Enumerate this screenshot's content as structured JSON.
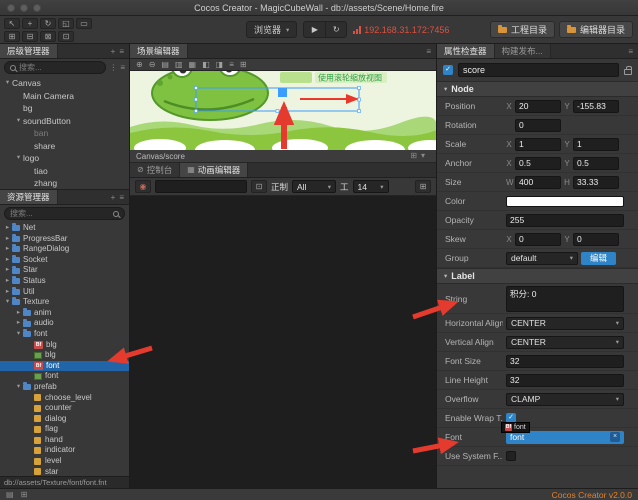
{
  "window": {
    "title": "Cocos Creator - MagicCubeWall - db://assets/Scene/Home.fire"
  },
  "toolbar": {
    "preview_target": "浏览器",
    "ip": "192.168.31.172:7456",
    "project_dir_label": "工程目录",
    "editor_dir_label": "编辑器目录"
  },
  "hierarchy": {
    "tab": "层级管理器",
    "search_placeholder": "搜索...",
    "items": [
      "Canvas",
      "Main Camera",
      "bg",
      "soundButton",
      "ban",
      "share",
      "logo",
      "tiao",
      "zhang"
    ]
  },
  "assets": {
    "tab": "资源管理器",
    "search_placeholder": "搜索...",
    "path": "db://assets/Texture/font/font.fnt",
    "items": [
      "Net",
      "ProgressBar",
      "RangeDialog",
      "Socket",
      "Star",
      "Status",
      "Util",
      "Texture",
      "anim",
      "audio",
      "font",
      "blg",
      "blg",
      "font",
      "font",
      "prefab",
      "choose_level",
      "counter",
      "dialog",
      "flag",
      "hand",
      "indicator",
      "level",
      "star"
    ]
  },
  "scene": {
    "tab": "场景编辑器",
    "hint": "使用滚轮缩放视图",
    "breadcrumb": "Canvas/score"
  },
  "bottom_panel": {
    "console_tab": "控制台",
    "animation_tab": "动画编辑器",
    "mode_label": "正制",
    "filter_value": "All",
    "size_value": "14"
  },
  "inspector": {
    "tab": "属性检查器",
    "build_tab": "构建发布...",
    "name_value": "score",
    "sections": {
      "node": "Node",
      "label": "Label"
    },
    "labels": {
      "position": "Position",
      "rotation": "Rotation",
      "scale": "Scale",
      "anchor": "Anchor",
      "size": "Size",
      "color": "Color",
      "opacity": "Opacity",
      "skew": "Skew",
      "group": "Group",
      "string": "String",
      "h_align": "Horizontal Align",
      "v_align": "Vertical Align",
      "font_size": "Font Size",
      "line_height": "Line Height",
      "overflow": "Overflow",
      "enable_wrap": "Enable Wrap T...",
      "font": "Font",
      "use_system": "Use System F..."
    },
    "axis": {
      "x": "X",
      "y": "Y",
      "w": "W",
      "h": "H"
    },
    "values": {
      "pos_x": "20",
      "pos_y": "-155.83",
      "rotation": "0",
      "scale_x": "1",
      "scale_y": "1",
      "anchor_x": "0.5",
      "anchor_y": "0.5",
      "size_w": "400",
      "size_h": "33.33",
      "opacity": "255",
      "skew_x": "0",
      "skew_y": "0",
      "group": "default",
      "string": "积分: 0",
      "h_align": "CENTER",
      "v_align": "CENTER",
      "font_size": "32",
      "line_height": "32",
      "overflow": "CLAMP",
      "font": "font",
      "font_tooltip": "font"
    },
    "edit_button": "编辑"
  },
  "statusbar": {
    "version": "Cocos Creator v2.0.0"
  },
  "colors": {
    "accent_blue": "#2f83c7",
    "selection_blue": "#2264a8",
    "annotation_red": "#e53b2e",
    "ip_red": "#e0503f",
    "version_orange": "#e0822e",
    "folder_orange": "#d8943a"
  },
  "icons": {
    "select": "↖",
    "move": "+",
    "rotate": "↻",
    "scale": "◱",
    "rect": "▭",
    "snap1": "⊞",
    "snap2": "⊟",
    "snap3": "⊠",
    "snap4": "⊡",
    "caret_down": "▾",
    "caret_right": "▸",
    "play": "▶",
    "refresh": "↻",
    "zoom_in": "⊕",
    "zoom_out": "⊖",
    "panel1": "▤",
    "panel2": "▥",
    "panel3": "▦",
    "panel4": "◧",
    "panel5": "◨",
    "menu": "≡",
    "plus": "+",
    "dots": "⋮",
    "ban": "⊘",
    "record": "◉",
    "check": "✓",
    "close": "×",
    "tool": "工",
    "grid": "⊞"
  }
}
